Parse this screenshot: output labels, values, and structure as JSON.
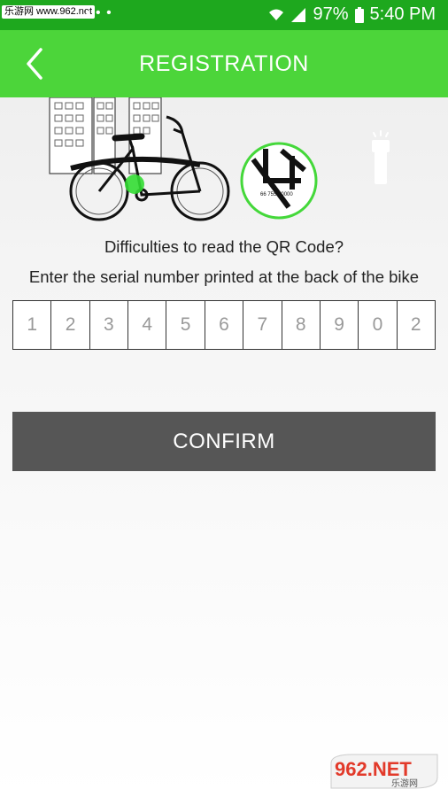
{
  "status_bar": {
    "watermark": "乐游网 www.962.net",
    "left_icons": "• • •",
    "battery": "97%",
    "time": "5:40 PM",
    "icons": [
      "wifi-icon",
      "signal-icon",
      "battery-icon"
    ]
  },
  "header": {
    "title": "REGISTRATION",
    "back_icon": "chevron-left-icon"
  },
  "illustration": {
    "serial_sample": "66 755 00000",
    "icons": [
      "bike-illustration",
      "qr-code-zoom-icon",
      "flashlight-icon"
    ]
  },
  "instructions": {
    "line1": "Difficulties to read the QR Code?",
    "line2": "Enter the serial number printed at the back of the bike"
  },
  "serial": {
    "cells": [
      "1",
      "2",
      "3",
      "4",
      "5",
      "6",
      "7",
      "8",
      "9",
      "0",
      "2"
    ]
  },
  "confirm": {
    "label": "CONFIRM"
  },
  "watermark_logo": {
    "text": "962.NET",
    "subtext": "乐游网"
  },
  "colors": {
    "status_bar": "#1ea81e",
    "app_bar": "#4cd53a",
    "button": "#565656",
    "highlight": "#33dd33"
  }
}
